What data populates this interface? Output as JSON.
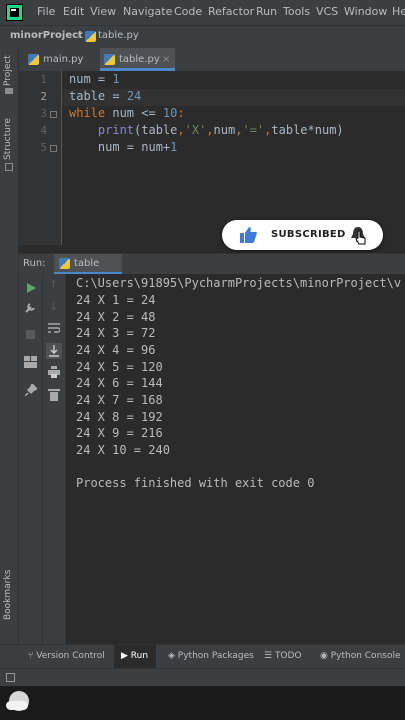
{
  "menubar": {
    "items": [
      "File",
      "Edit",
      "View",
      "Navigate",
      "Code",
      "Refactor",
      "Run",
      "Tools",
      "VCS",
      "Window",
      "He"
    ]
  },
  "navbar": {
    "project": "minorProject",
    "file": "table.py"
  },
  "left_strip": {
    "project": "Project",
    "structure": "Structure",
    "bookmarks": "Bookmarks"
  },
  "editor": {
    "tabs": [
      {
        "label": "main.py",
        "active": false
      },
      {
        "label": "table.py",
        "active": true
      }
    ],
    "line_numbers": [
      "1",
      "2",
      "3",
      "4",
      "5"
    ],
    "current_line": 2,
    "code": [
      {
        "t1": "num",
        "t2": " = ",
        "t3": "1"
      },
      {
        "t1": "table",
        "t2": " = ",
        "t3": "24"
      },
      {
        "kw": "while",
        "t1": " num <= ",
        "n": "10",
        "t2": ":"
      },
      {
        "indent": "    ",
        "fn": "print",
        "a": "(table",
        "s1": "'X'",
        "b": "num",
        "s2": "'='",
        "c": "table*num)"
      },
      {
        "indent": "    ",
        "t1": "num = num+",
        "n": "1"
      }
    ]
  },
  "subscribe": {
    "label": "SUBSCRIBED"
  },
  "run_panel": {
    "label": "Run:",
    "tab": "table",
    "path": "C:\\Users\\91895\\PycharmProjects\\minorProject\\v",
    "output": [
      "24 X 1 = 24",
      "24 X 2 = 48",
      "24 X 3 = 72",
      "24 X 4 = 96",
      "24 X 5 = 120",
      "24 X 6 = 144",
      "24 X 7 = 168",
      "24 X 8 = 192",
      "24 X 9 = 216",
      "24 X 10 = 240"
    ],
    "finished": "Process finished with exit code 0"
  },
  "bottom_bar": {
    "version_control": "Version Control",
    "run": "Run",
    "python_packages": "Python Packages",
    "todo": "TODO",
    "python_console": "Python Console"
  },
  "colors": {
    "accent": "#4a88c7",
    "keyword": "#cc7832",
    "number": "#6897bb",
    "string": "#6a8759",
    "builtin": "#8888c6"
  }
}
